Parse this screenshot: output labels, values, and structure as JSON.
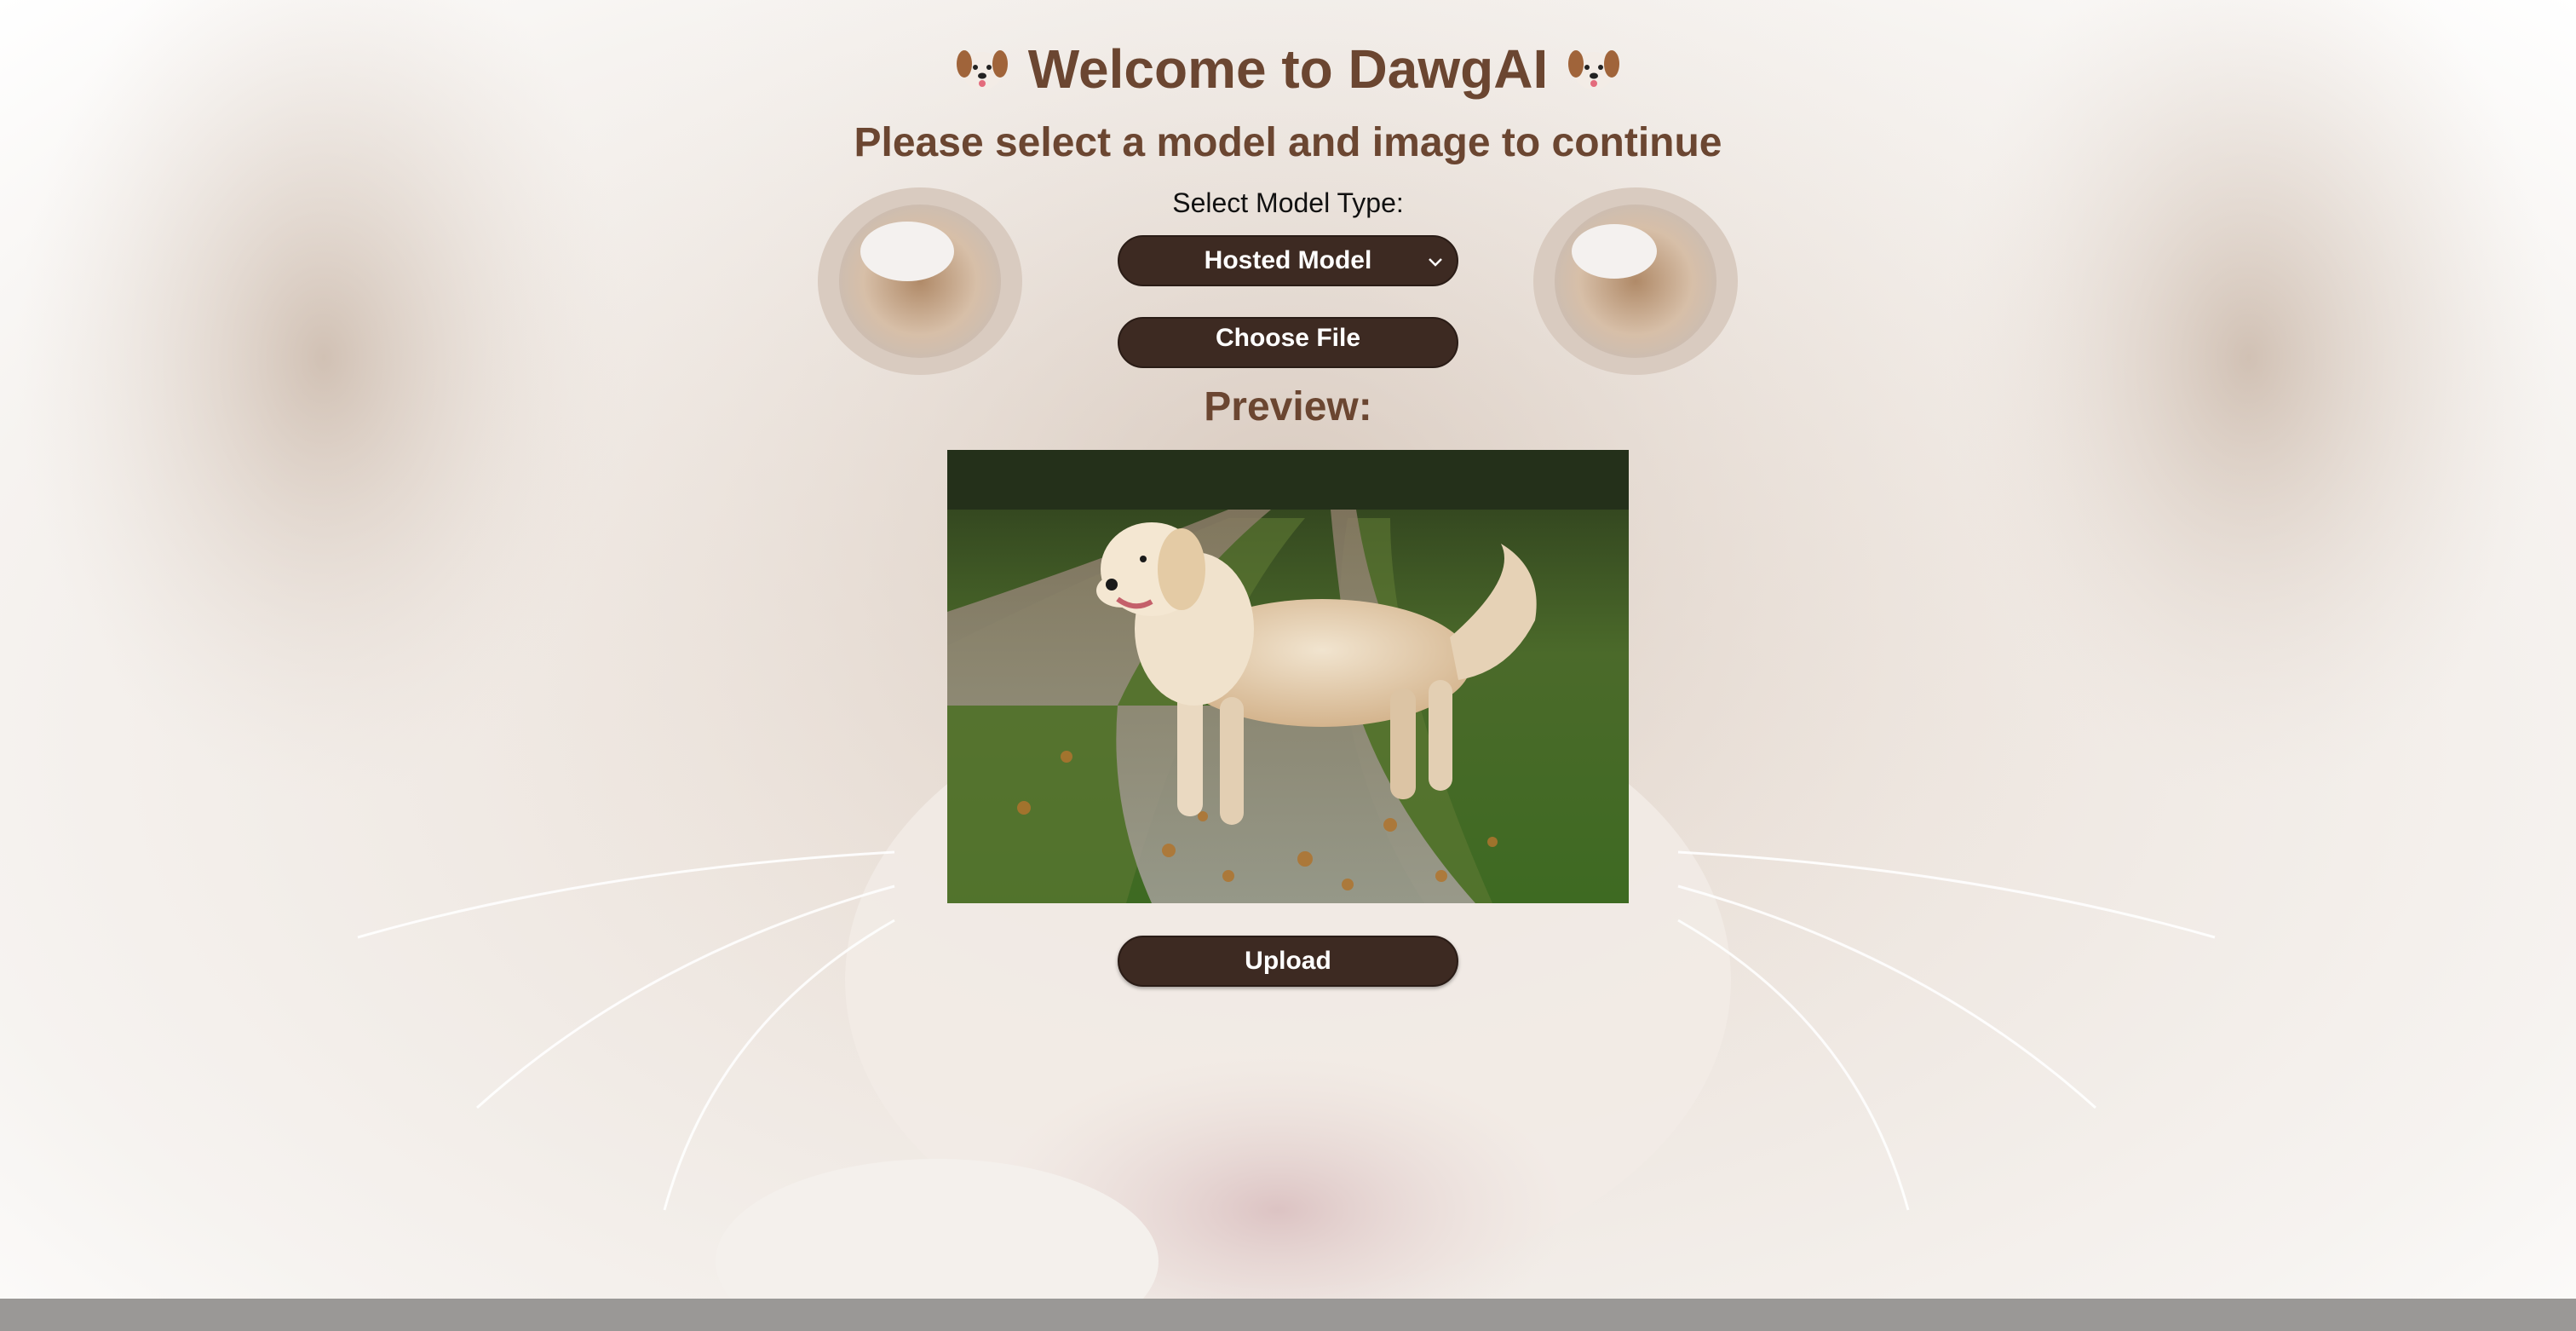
{
  "header": {
    "title": "Welcome to DawgAI",
    "title_icon": "dog-face-icon",
    "subtitle": "Please select a model and image to continue"
  },
  "form": {
    "model_label": "Select Model Type:",
    "model_selected": "Hosted Model",
    "choose_file_label": "Choose File",
    "preview_label": "Preview:",
    "upload_label": "Upload"
  },
  "colors": {
    "brand_brown": "#6b4631",
    "button_bg": "#3d2a22"
  }
}
